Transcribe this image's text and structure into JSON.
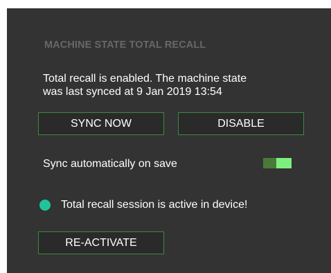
{
  "panel": {
    "title": "MACHINE STATE TOTAL RECALL",
    "status_line1": "Total recall is enabled. The machine state",
    "status_line2": "was last synced at 9 Jan 2019 13:54"
  },
  "buttons": {
    "sync_now": "SYNC NOW",
    "disable": "DISABLE",
    "reactivate": "RE-ACTIVATE"
  },
  "auto_sync": {
    "label": "Sync automatically on save",
    "enabled": true
  },
  "session": {
    "status_text": "Total recall session is active in device!",
    "indicator_color": "#21c49a"
  },
  "colors": {
    "background": "#333333",
    "button_border": "#3d8a3d",
    "toggle_on": "#7ef07e",
    "title": "#676767"
  }
}
